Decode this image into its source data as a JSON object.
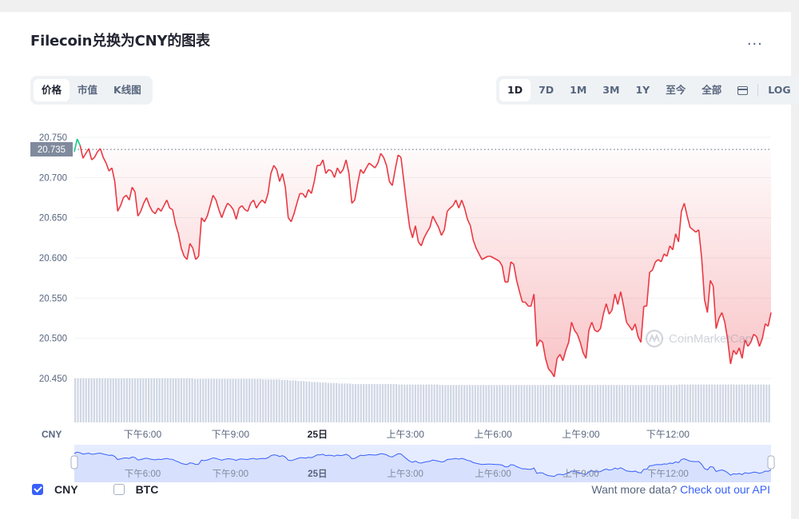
{
  "header": {
    "title": "Filecoin兑换为CNY的图表",
    "more_label": "..."
  },
  "view_tabs": [
    {
      "label": "价格",
      "active": true
    },
    {
      "label": "市值",
      "active": false
    },
    {
      "label": "K线图",
      "active": false
    }
  ],
  "range_tabs": [
    {
      "label": "1D",
      "active": true
    },
    {
      "label": "7D",
      "active": false
    },
    {
      "label": "1M",
      "active": false
    },
    {
      "label": "3M",
      "active": false
    },
    {
      "label": "1Y",
      "active": false
    },
    {
      "label": "至今",
      "active": false
    },
    {
      "label": "全部",
      "active": false
    }
  ],
  "log_label": "LOG",
  "watermark": "CoinMarketCap",
  "currency_label": "CNY",
  "legend": [
    {
      "label": "CNY",
      "checked": true
    },
    {
      "label": "BTC",
      "checked": false
    }
  ],
  "footer": {
    "text": "Want more data?",
    "link": "Check out our API"
  },
  "colors": {
    "line_down": "#ea3943",
    "line_up": "#16c784",
    "accent": "#3861fb",
    "nav_line": "#3861fb"
  },
  "chart_data": {
    "type": "line",
    "yticks": [
      "20.750",
      "20.700",
      "20.650",
      "20.600",
      "20.550",
      "20.500",
      "20.450"
    ],
    "ytick_values": [
      20.75,
      20.7,
      20.65,
      20.6,
      20.55,
      20.5,
      20.45
    ],
    "ylim": [
      20.4,
      20.76
    ],
    "current_price": "20.735",
    "current_value": 20.735,
    "xticks": [
      {
        "label": "下午6:00",
        "t": 0.098,
        "bold": false
      },
      {
        "label": "下午9:00",
        "t": 0.224,
        "bold": false
      },
      {
        "label": "25日",
        "t": 0.349,
        "bold": true
      },
      {
        "label": "上午3:00",
        "t": 0.475,
        "bold": false
      },
      {
        "label": "上午6:00",
        "t": 0.601,
        "bold": false
      },
      {
        "label": "上午9:00",
        "t": 0.727,
        "bold": false
      },
      {
        "label": "下午12:00",
        "t": 0.852,
        "bold": false
      }
    ],
    "values": [
      20.732,
      20.748,
      20.74,
      20.724,
      20.73,
      20.736,
      20.722,
      20.725,
      20.732,
      20.736,
      20.725,
      20.718,
      20.708,
      20.712,
      20.695,
      20.658,
      20.665,
      20.675,
      20.678,
      20.672,
      20.688,
      20.682,
      20.652,
      20.658,
      20.668,
      20.675,
      20.665,
      20.658,
      20.655,
      20.662,
      20.658,
      20.665,
      20.672,
      20.662,
      20.66,
      20.642,
      20.63,
      20.612,
      20.602,
      20.598,
      20.618,
      20.612,
      20.598,
      20.602,
      20.65,
      20.645,
      20.652,
      20.665,
      20.678,
      20.672,
      20.66,
      20.65,
      20.66,
      20.668,
      20.665,
      20.66,
      20.648,
      20.662,
      20.665,
      20.66,
      20.658,
      20.668,
      20.672,
      20.662,
      20.668,
      20.672,
      20.668,
      20.68,
      20.705,
      20.715,
      20.71,
      20.695,
      20.705,
      20.688,
      20.65,
      20.645,
      20.655,
      20.668,
      20.68,
      20.68,
      20.675,
      20.685,
      20.68,
      20.695,
      20.715,
      20.715,
      20.722,
      20.705,
      20.71,
      20.708,
      20.7,
      20.712,
      20.705,
      20.71,
      20.722,
      20.705,
      20.668,
      20.672,
      20.692,
      20.71,
      20.705,
      20.712,
      20.718,
      20.715,
      20.712,
      20.718,
      20.73,
      20.725,
      20.715,
      20.695,
      20.69,
      20.71,
      20.728,
      20.725,
      20.695,
      20.665,
      20.638,
      20.625,
      20.64,
      20.62,
      20.615,
      20.625,
      20.632,
      20.638,
      20.652,
      20.645,
      20.638,
      20.628,
      20.635,
      20.658,
      20.662,
      20.665,
      20.672,
      20.662,
      20.672,
      20.662,
      20.648,
      20.64,
      20.622,
      20.612,
      20.605,
      20.598,
      20.6,
      20.602,
      20.602,
      20.6,
      20.598,
      20.596,
      20.59,
      20.57,
      20.57,
      20.595,
      20.592,
      20.572,
      20.558,
      20.545,
      20.545,
      20.54,
      20.54,
      20.555,
      20.49,
      20.498,
      20.495,
      20.475,
      20.462,
      20.458,
      20.452,
      20.475,
      20.48,
      20.472,
      20.485,
      20.495,
      20.52,
      20.51,
      20.505,
      20.495,
      20.482,
      20.475,
      20.51,
      20.52,
      20.51,
      20.508,
      20.512,
      20.53,
      20.543,
      20.53,
      20.535,
      20.555,
      20.542,
      20.558,
      20.54,
      20.52,
      20.515,
      20.51,
      20.518,
      20.502,
      20.495,
      20.54,
      20.54,
      20.582,
      20.585,
      20.595,
      20.598,
      20.595,
      20.605,
      20.602,
      20.615,
      20.61,
      20.63,
      20.62,
      20.658,
      20.668,
      20.652,
      20.638,
      20.635,
      20.632,
      20.635,
      20.6,
      20.548,
      20.532,
      20.572,
      20.565,
      20.512,
      20.525,
      20.532,
      20.52,
      20.498,
      20.468,
      20.485,
      20.48,
      20.488,
      20.475,
      20.498,
      20.49,
      20.495,
      20.505,
      20.502,
      20.49,
      20.5,
      20.518,
      20.515,
      20.532
    ],
    "volume": [
      0.87,
      0.87,
      0.87,
      0.87,
      0.87,
      0.87,
      0.87,
      0.87,
      0.87,
      0.87,
      0.87,
      0.87,
      0.87,
      0.87,
      0.87,
      0.87,
      0.87,
      0.87,
      0.87,
      0.87,
      0.87,
      0.87,
      0.87,
      0.87,
      0.87,
      0.87,
      0.87,
      0.87,
      0.87,
      0.87,
      0.87,
      0.87,
      0.87,
      0.87,
      0.87,
      0.87,
      0.87,
      0.87,
      0.87,
      0.87,
      0.87,
      0.87,
      0.87,
      0.87,
      0.86,
      0.86,
      0.86,
      0.86,
      0.86,
      0.86,
      0.86,
      0.86,
      0.86,
      0.86,
      0.86,
      0.86,
      0.86,
      0.86,
      0.86,
      0.86,
      0.86,
      0.86,
      0.86,
      0.86,
      0.86,
      0.86,
      0.86,
      0.86,
      0.86,
      0.85,
      0.85,
      0.85,
      0.85,
      0.85,
      0.85,
      0.85,
      0.84,
      0.84,
      0.84,
      0.83,
      0.83,
      0.83,
      0.82,
      0.82,
      0.82,
      0.81,
      0.81,
      0.8,
      0.8,
      0.8,
      0.79,
      0.79,
      0.79,
      0.78,
      0.78,
      0.78,
      0.78,
      0.77,
      0.77,
      0.77,
      0.77,
      0.77,
      0.76,
      0.76,
      0.76,
      0.76,
      0.76,
      0.76,
      0.76,
      0.76,
      0.76,
      0.76,
      0.76,
      0.76,
      0.76,
      0.76,
      0.76,
      0.76,
      0.76,
      0.75,
      0.75,
      0.75,
      0.75,
      0.75,
      0.75,
      0.75,
      0.75,
      0.75,
      0.75,
      0.75,
      0.75,
      0.75,
      0.75,
      0.75,
      0.74,
      0.74,
      0.74,
      0.74,
      0.74,
      0.74,
      0.74,
      0.74,
      0.74,
      0.74,
      0.74,
      0.74,
      0.74,
      0.74,
      0.74,
      0.74,
      0.74,
      0.74,
      0.74,
      0.74,
      0.74,
      0.74,
      0.74,
      0.74,
      0.74,
      0.74,
      0.74,
      0.74,
      0.74,
      0.74,
      0.74,
      0.74,
      0.74,
      0.74,
      0.74,
      0.74,
      0.74,
      0.74,
      0.74,
      0.74,
      0.74,
      0.74,
      0.74,
      0.74,
      0.74,
      0.74,
      0.74,
      0.74,
      0.74,
      0.74,
      0.74,
      0.74,
      0.74,
      0.74,
      0.74,
      0.74,
      0.74,
      0.74,
      0.74,
      0.74,
      0.74,
      0.74,
      0.74,
      0.74,
      0.74,
      0.74,
      0.74,
      0.74,
      0.74,
      0.74,
      0.74,
      0.74,
      0.74,
      0.74,
      0.74,
      0.74,
      0.74,
      0.74,
      0.74,
      0.74,
      0.74,
      0.74,
      0.74,
      0.74,
      0.74,
      0.74,
      0.74,
      0.74,
      0.75,
      0.75,
      0.75,
      0.75,
      0.75,
      0.75,
      0.75,
      0.75,
      0.75,
      0.75,
      0.75,
      0.75,
      0.75,
      0.75,
      0.75,
      0.75,
      0.75,
      0.75,
      0.75,
      0.75,
      0.75,
      0.75,
      0.75,
      0.75,
      0.75,
      0.75,
      0.75,
      0.75,
      0.75,
      0.75,
      0.75,
      0.75,
      0.75,
      0.75
    ]
  }
}
